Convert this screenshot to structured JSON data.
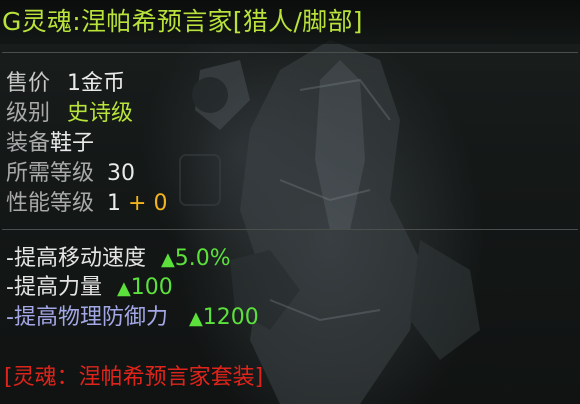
{
  "item": {
    "title": "G灵魂:涅帕希预言家[猎人/脚部]",
    "price": {
      "label": "售价",
      "value": "1金币"
    },
    "grade": {
      "label": "级别",
      "value": "史诗级"
    },
    "equip": {
      "label": "装备",
      "value": "鞋子"
    },
    "required_level": {
      "label": "所需等级",
      "value": "30"
    },
    "performance_level": {
      "label": "性能等级",
      "base": "1",
      "bonus": "+ 0"
    },
    "stats": [
      {
        "name": "-提高移动速度",
        "value": "5.0%"
      },
      {
        "name": "-提高力量",
        "value": "100"
      },
      {
        "name": "-提高物理防御力",
        "value": "1200"
      }
    ],
    "set_name": "[灵魂：涅帕希预言家套装]"
  },
  "colors": {
    "title": "#b9e33a",
    "grade_epic": "#b8e33a",
    "bonus": "#f3b41d",
    "stat_value": "#5ce13c",
    "stat_special": "#a3a7e6",
    "set_name": "#e0241b"
  },
  "icons": {
    "stat_up": "up-triangle-icon"
  }
}
